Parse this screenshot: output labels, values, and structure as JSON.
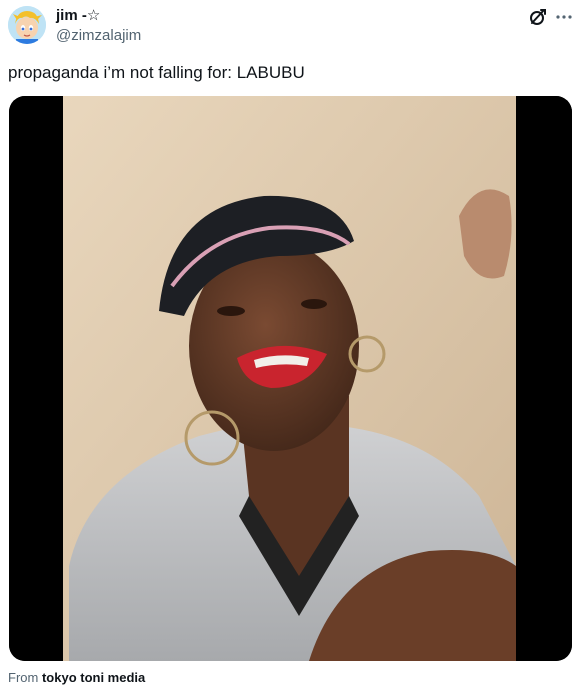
{
  "tweet": {
    "display_name": "jim -☆",
    "handle": "@zimzalajim",
    "text": "propaganda i’m not falling for: LABUBU",
    "source_prefix": "From",
    "source_name": "tokyo toni media"
  },
  "icons": {
    "avatar": "avatar-cartoon-boy",
    "grok": "grok-icon",
    "more": "more-options-icon"
  },
  "colors": {
    "text": "#0f1419",
    "secondary": "#536471",
    "media_background": "#000000",
    "wall": "#e9d7bd"
  }
}
